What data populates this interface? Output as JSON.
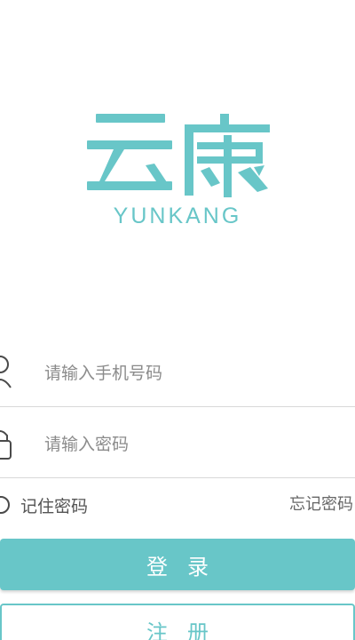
{
  "brand": {
    "logo_text": "云康",
    "logo_subtitle": "YUNKANG",
    "accent_color": "#68c6c8"
  },
  "login_form": {
    "phone_field": {
      "icon": "user-icon",
      "placeholder": "请输入手机号码",
      "value": ""
    },
    "password_field": {
      "icon": "lock-icon",
      "placeholder": "请输入密码",
      "value": ""
    },
    "remember_password": {
      "label": "记住密码",
      "checked": false
    },
    "forgot_password_label": "忘记密码",
    "login_button_label": "登录",
    "register_button_label": "注册"
  }
}
